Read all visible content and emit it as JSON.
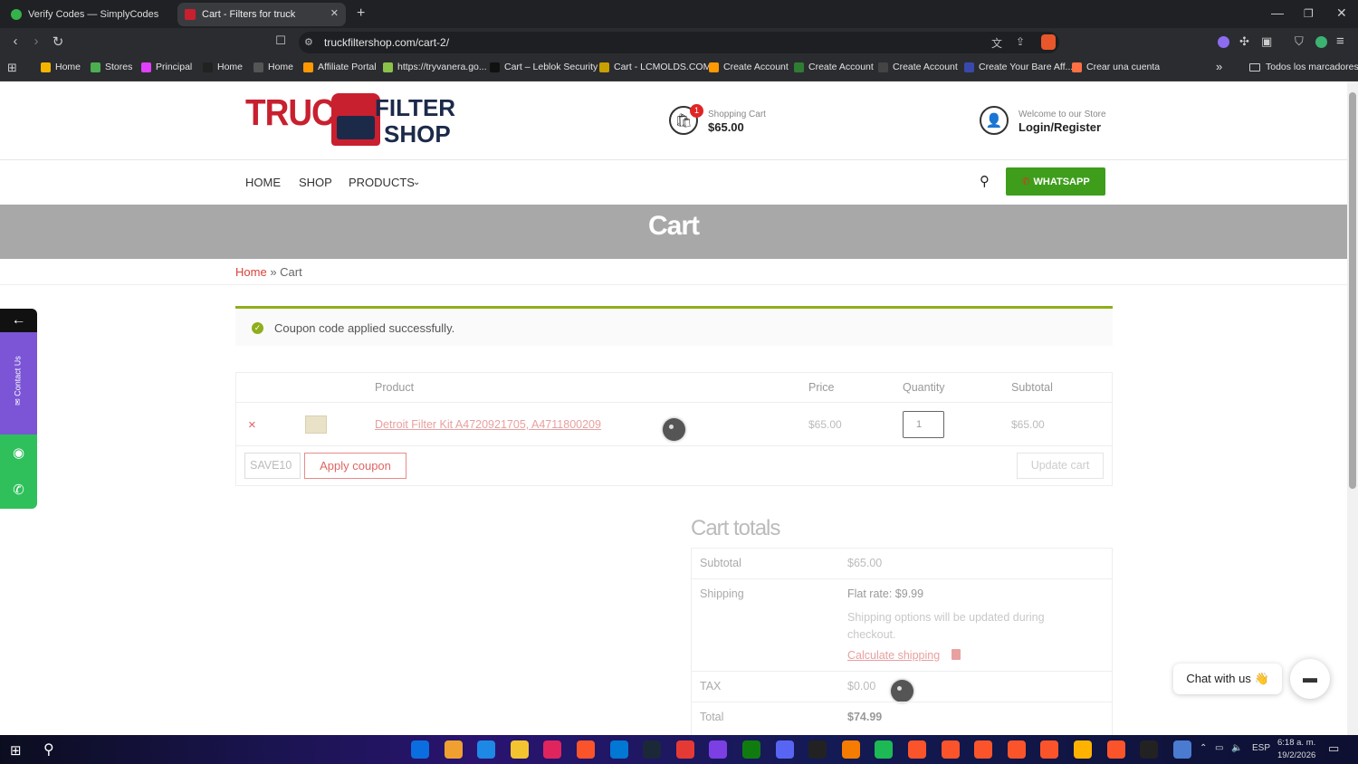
{
  "browser": {
    "tabs": [
      {
        "label": "Verify Codes — SimplyCodes",
        "active": false
      },
      {
        "label": "Cart - Filters for truck",
        "active": true
      }
    ],
    "new_tab": "+",
    "window_controls": {
      "minimize": "—",
      "restore": "❐",
      "close": "✕"
    },
    "url": "truckfiltershop.com/cart-2/",
    "bookmarks": [
      {
        "label": "Home",
        "color": "#f4b400"
      },
      {
        "label": "Stores",
        "color": "#4caf50"
      },
      {
        "label": "Principal",
        "color": "#e040fb"
      },
      {
        "label": "Home",
        "color": "#222"
      },
      {
        "label": "Home",
        "color": "#555"
      },
      {
        "label": "Affiliate Portal",
        "color": "#ff9800"
      },
      {
        "label": "https://tryvanera.go...",
        "color": "#8bc34a"
      },
      {
        "label": "Cart – Leblok Security",
        "color": "#111"
      },
      {
        "label": "Cart - LCMOLDS.COM",
        "color": "#c8a000"
      },
      {
        "label": "Create Account",
        "color": "#ff9900"
      },
      {
        "label": "Create Account",
        "color": "#2e7d32"
      },
      {
        "label": "Create Account",
        "color": "#444"
      },
      {
        "label": "Create Your Bare Aff...",
        "color": "#3949ab"
      },
      {
        "label": "Crear una cuenta",
        "color": "#ff7043"
      }
    ],
    "bookmarks_more": "»",
    "all_bookmarks": "Todos los marcadores"
  },
  "site": {
    "logo": {
      "truck": "TRUCK",
      "filter": "FILTER",
      "shop": "SHOP"
    },
    "cart": {
      "label": "Shopping Cart",
      "amount": "$65.00",
      "count": "1"
    },
    "account": {
      "welcome": "Welcome to our Store",
      "login": "Login/Register"
    },
    "nav": {
      "home": "HOME",
      "shop": "SHOP",
      "products": "PRODUCTS"
    },
    "whatsapp_button": "WHATSAPP",
    "page_title": "Cart",
    "breadcrumb": {
      "home": "Home",
      "sep": "»",
      "current": "Cart"
    },
    "notice": "Coupon code applied successfully.",
    "table": {
      "headers": {
        "product": "Product",
        "price": "Price",
        "quantity": "Quantity",
        "subtotal": "Subtotal"
      },
      "row": {
        "remove": "×",
        "product_name": "Detroit Filter Kit A4720921705, A4711800209",
        "price": "$65.00",
        "quantity": "1",
        "subtotal": "$65.00"
      },
      "coupon_value": "SAVE10",
      "apply_coupon": "Apply coupon",
      "update_cart": "Update cart"
    },
    "totals": {
      "heading": "Cart totals",
      "subtotal_label": "Subtotal",
      "subtotal_value": "$65.00",
      "shipping_label": "Shipping",
      "shipping_rate": "Flat rate: $9.99",
      "shipping_note": "Shipping options will be updated during checkout.",
      "calculate_shipping": "Calculate shipping",
      "tax_label": "TAX",
      "tax_value": "$0.00",
      "total_label": "Total",
      "total_value": "$74.99"
    },
    "side_widget": {
      "back": "←",
      "contact": "Contact Us"
    },
    "chat": {
      "label": "Chat with us 👋"
    }
  },
  "taskbar": {
    "lang": "ESP",
    "time": "6:18 a. m.",
    "date": "19/2/2026"
  },
  "colors": {
    "brand_red": "#c8202f",
    "brand_navy": "#1c2a4a",
    "whatsapp_green": "#3f9d1c",
    "success": "#8fae1b",
    "link_red": "#e06565"
  }
}
